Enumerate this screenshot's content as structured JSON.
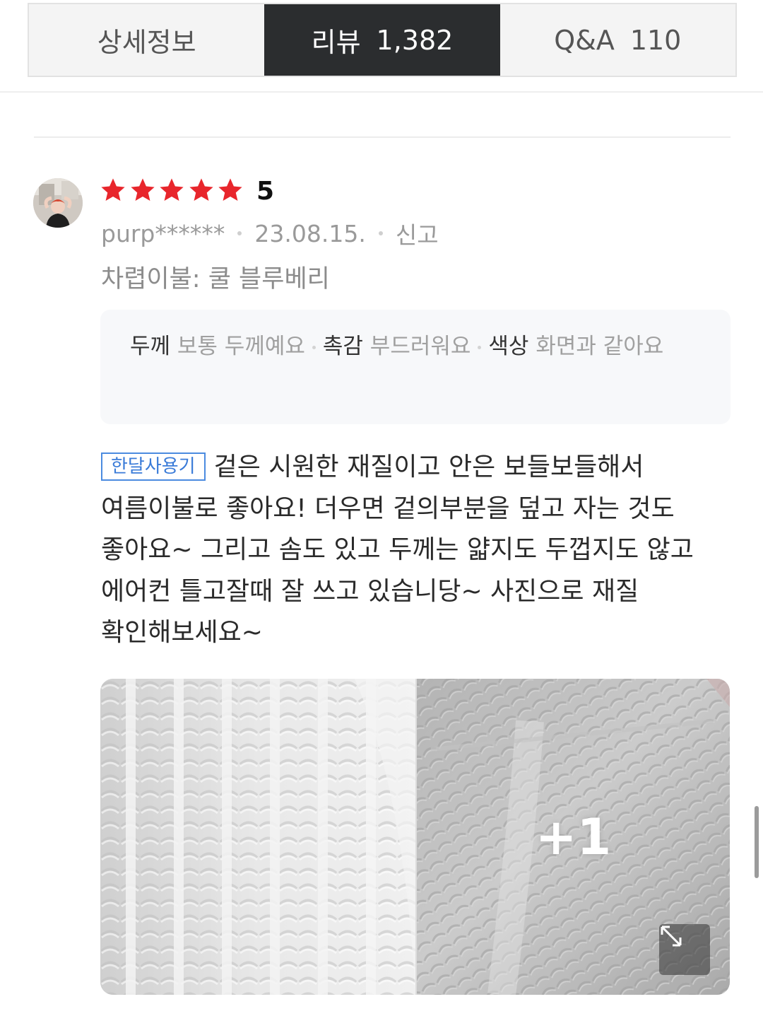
{
  "tabs": [
    {
      "label": "상세정보",
      "count": ""
    },
    {
      "label": "리뷰",
      "count": "1,382"
    },
    {
      "label": "Q&A",
      "count": "110"
    }
  ],
  "active_tab_index": 1,
  "review": {
    "rating": "5",
    "stars_filled": 5,
    "star_color": "#e8262c",
    "username": "purp******",
    "date": "23.08.15.",
    "report_label": "신고",
    "option": "차렵이불: 쿨 블루베리",
    "attributes": [
      {
        "key": "두께",
        "value": "보통 두께예요"
      },
      {
        "key": "촉감",
        "value": "부드러워요"
      },
      {
        "key": "색상",
        "value": "화면과 같아요"
      }
    ],
    "badge": "한달사용기",
    "badge_color": "#3a7bd8",
    "text": "겉은 시원한 재질이고 안은 보들보들해서 여름이불로 좋아요! 더우면 겉의부분을 덮고 자는 것도 좋아요~ 그리고 솜도 있고 두께는 얇지도 두껍지도 않고 에어컨 틀고잘때 잘 쓰고 있습니당~ 사진으로 재질 확인해보세요~",
    "more_photos": "+1"
  },
  "icons": {
    "star": "star-icon",
    "expand": "expand-icon"
  },
  "colors": {
    "active_tab_bg": "#2b2d2f",
    "tab_bg": "#f4f4f4"
  }
}
